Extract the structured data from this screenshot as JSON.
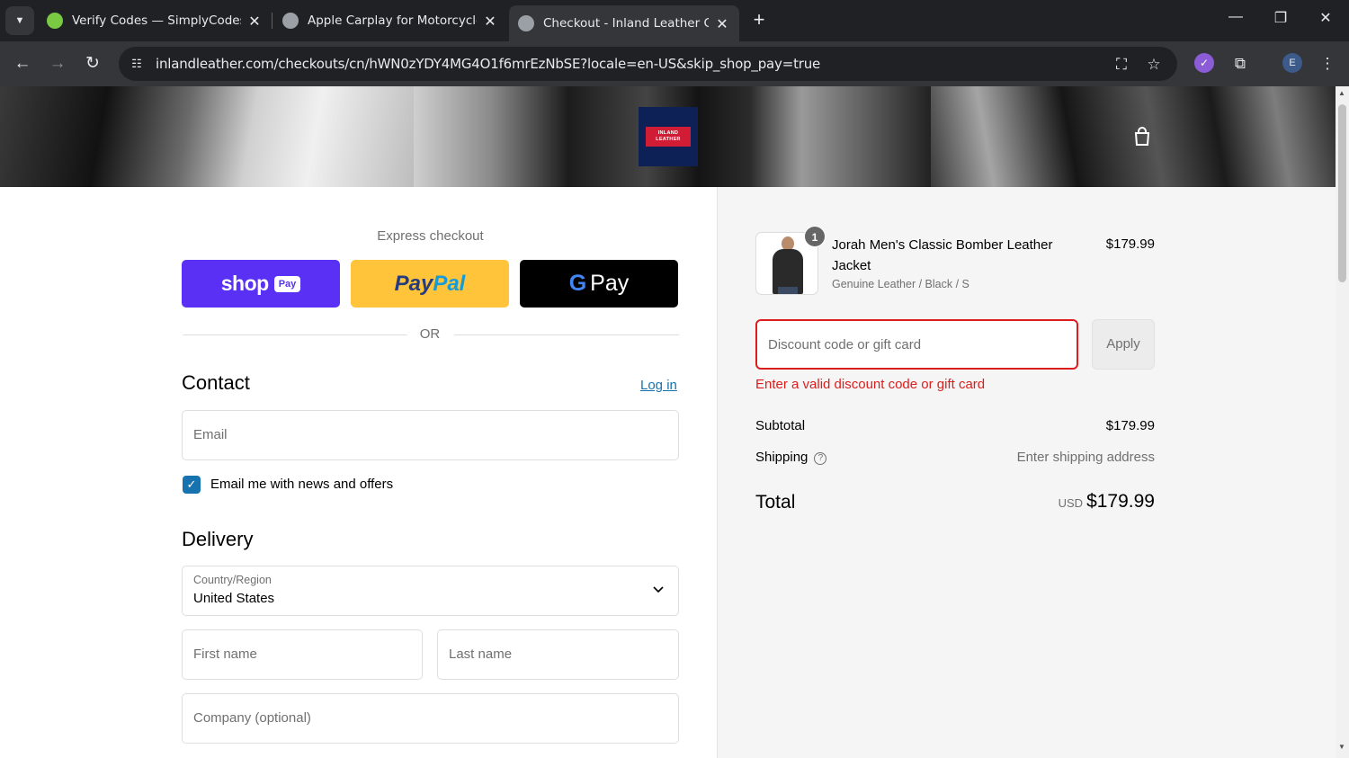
{
  "browser": {
    "tabs": [
      {
        "title": "Verify Codes — SimplyCodes",
        "favicon_color": "#7ac943"
      },
      {
        "title": "Apple Carplay for Motorcycles (",
        "favicon_color": "#9aa0a6"
      },
      {
        "title": "Checkout - Inland Leather Co",
        "favicon_color": "#9aa0a6"
      }
    ],
    "url": "inlandleather.com/checkouts/cn/hWN0zYDY4MG4O1f6mrEzNbSE?locale=en-US&skip_shop_pay=true",
    "profile_initial": "E"
  },
  "store": {
    "logo_line1": "INLAND",
    "logo_line2": "LEATHER"
  },
  "checkout": {
    "express_label": "Express checkout",
    "shop_word": "shop",
    "shop_pill": "Pay",
    "paypal_a": "Pay",
    "paypal_b": "Pal",
    "gpay_g": "G",
    "gpay_pay": "Pay",
    "or_text": "OR",
    "contact_title": "Contact",
    "login_link": "Log in",
    "email_placeholder": "Email",
    "news_checkbox_label": "Email me with news and offers",
    "delivery_title": "Delivery",
    "country_label": "Country/Region",
    "country_value": "United States",
    "first_name_placeholder": "First name",
    "last_name_placeholder": "Last name",
    "company_placeholder": "Company (optional)"
  },
  "summary": {
    "product": {
      "name": "Jorah Men's Classic Bomber Leather Jacket",
      "variant": "Genuine Leather / Black / S",
      "price": "$179.99",
      "quantity": "1"
    },
    "discount_placeholder": "Discount code or gift card",
    "apply_label": "Apply",
    "discount_error": "Enter a valid discount code or gift card",
    "subtotal_label": "Subtotal",
    "subtotal_value": "$179.99",
    "shipping_label": "Shipping",
    "shipping_value": "Enter shipping address",
    "total_label": "Total",
    "total_currency": "USD",
    "total_value": "$179.99"
  },
  "colors": {
    "shop_pay": "#5a31f4",
    "paypal": "#ffc439",
    "error": "#dd1d1d",
    "link": "#1773b0"
  }
}
